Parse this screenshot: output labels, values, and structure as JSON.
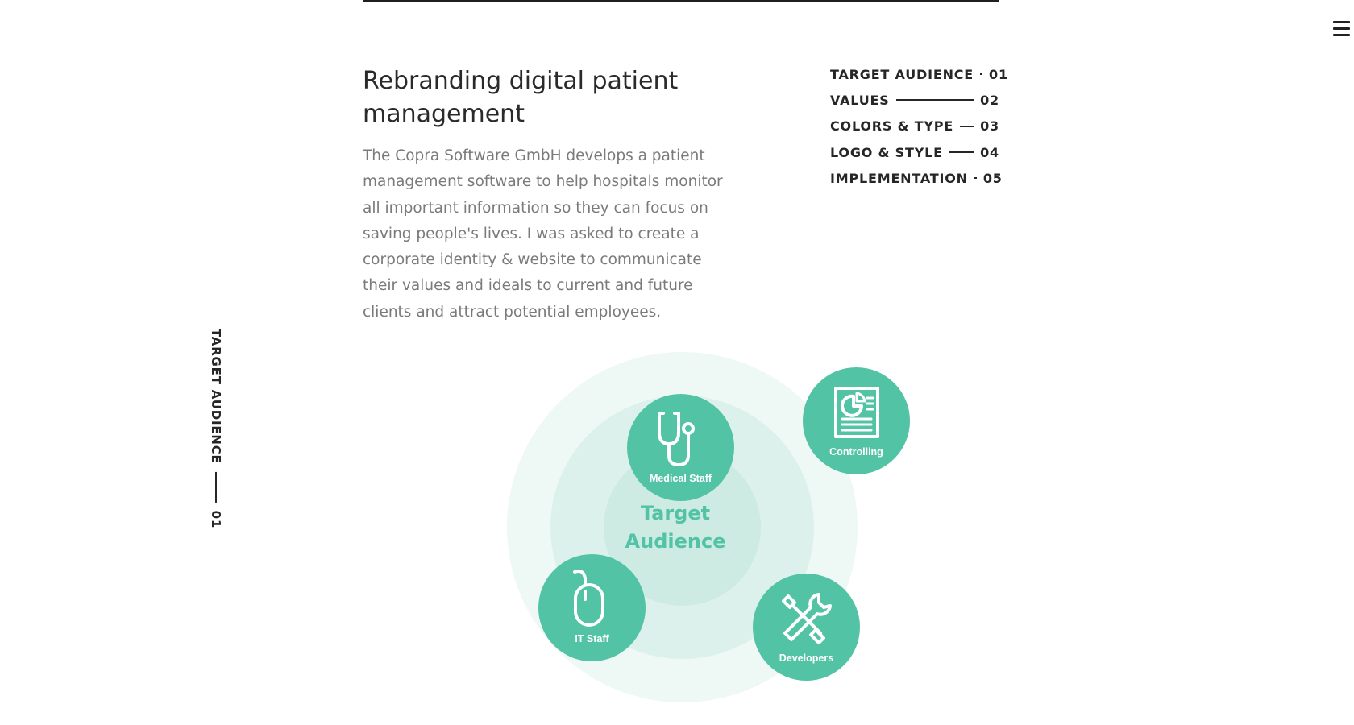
{
  "page": {
    "headline": "Rebranding digital patient management",
    "intro": "The Copra Software GmbH develops a patient management software to help hospitals monitor all important information so they can focus on saving people's lives. I was asked to create a corporate identity & website to communicate their values and ideals to current and future clients and attract potential employees."
  },
  "toc": [
    {
      "label": "TARGET AUDIENCE",
      "num": "01"
    },
    {
      "label": "VALUES",
      "num": "02"
    },
    {
      "label": "COLORS & TYPE",
      "num": "03"
    },
    {
      "label": "LOGO & STYLE",
      "num": "04"
    },
    {
      "label": "IMPLEMENTATION",
      "num": "05"
    }
  ],
  "side": {
    "label": "TARGET AUDIENCE",
    "num": "01"
  },
  "diagram": {
    "center": [
      "Target",
      "Audience"
    ],
    "nodes": [
      {
        "label": "Medical Staff",
        "icon": "stethoscope-icon"
      },
      {
        "label": "Controlling",
        "icon": "report-chart-icon"
      },
      {
        "label": "IT Staff",
        "icon": "computer-mouse-icon"
      },
      {
        "label": "Developers",
        "icon": "wrench-screwdriver-icon"
      }
    ]
  },
  "colors": {
    "accent": "#52c3a5",
    "ring_outer": "#eef8f5",
    "ring_mid": "#ddf1ec",
    "ring_inner": "#cdebe3",
    "text": "#262626",
    "body_text": "#7a7a7a"
  }
}
